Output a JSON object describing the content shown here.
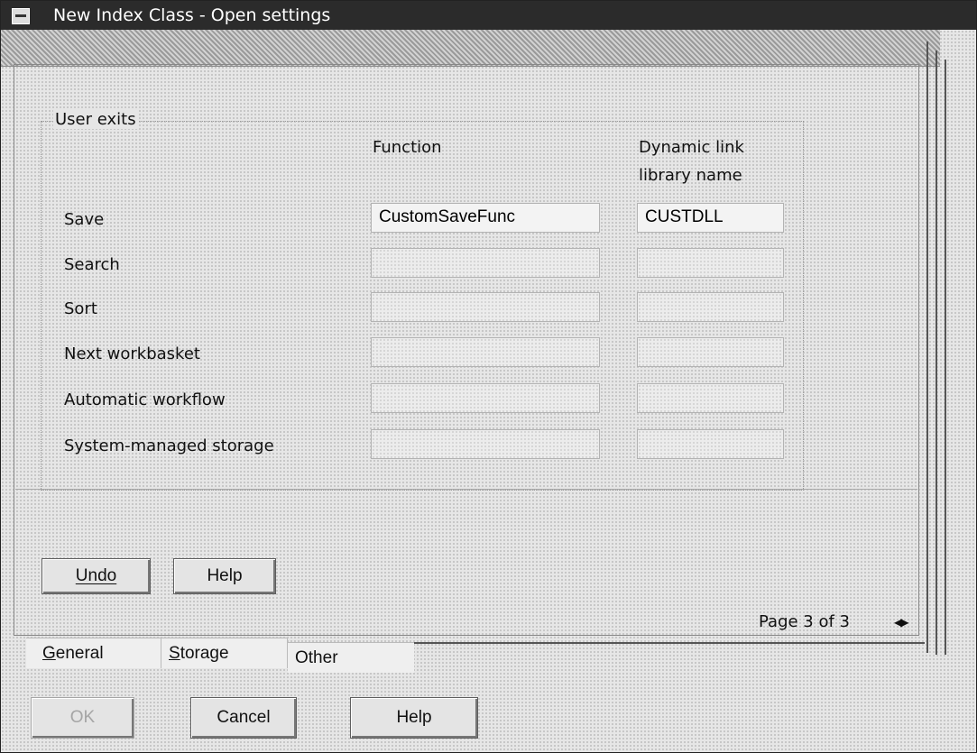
{
  "window": {
    "title": "New Index Class - Open settings"
  },
  "group": {
    "title": "User exits",
    "columns": {
      "function": "Function",
      "dll_line1": "Dynamic link",
      "dll_line2": "library name"
    },
    "rows": [
      {
        "label": "Save",
        "function": "CustomSaveFunc",
        "dll": "CUSTDLL"
      },
      {
        "label": "Search",
        "function": "",
        "dll": ""
      },
      {
        "label": "Sort",
        "function": "",
        "dll": ""
      },
      {
        "label": "Next workbasket",
        "function": "",
        "dll": ""
      },
      {
        "label": "Automatic workflow",
        "function": "",
        "dll": ""
      },
      {
        "label": "System-managed storage",
        "function": "",
        "dll": ""
      }
    ]
  },
  "page_buttons": {
    "undo": "Undo",
    "help": "Help"
  },
  "pagination": {
    "text": "Page 3 of 3"
  },
  "tabs": [
    {
      "label": "General",
      "mnemonic": "G",
      "rest": "eneral"
    },
    {
      "label": "Storage",
      "mnemonic": "S",
      "rest": "torage"
    },
    {
      "label": "Other"
    }
  ],
  "dialog_buttons": {
    "ok": "OK",
    "cancel": "Cancel",
    "help": "Help"
  },
  "icons": {
    "system_menu": "system-menu-icon",
    "page_arrows": "page-arrows-icon"
  }
}
